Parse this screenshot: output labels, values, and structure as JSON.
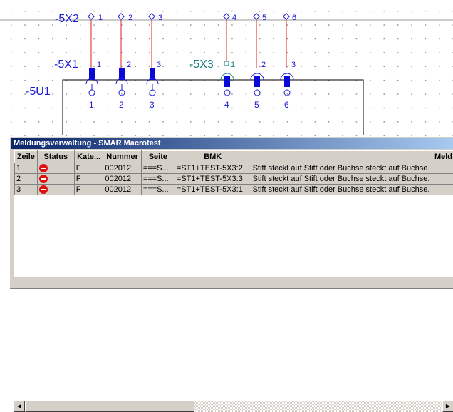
{
  "schematic": {
    "device_label": "-5U1",
    "strip_top": {
      "label": "-5X2",
      "pins_left": [
        "1",
        "2",
        "3"
      ],
      "pins_right": [
        "4",
        "5",
        "6"
      ]
    },
    "strip_mid_left": {
      "label": "-5X1",
      "pins": [
        "1",
        "2",
        "3"
      ]
    },
    "strip_mid_right": {
      "label": "-5X3",
      "pins": [
        "1",
        "2",
        "3"
      ]
    },
    "bottom_numbers": [
      "1",
      "2",
      "3",
      "4",
      "5",
      "6"
    ],
    "colors": {
      "label_blue": "#1a1ad6",
      "label_teal": "#1a8080",
      "wire_red": "#e02020",
      "block_blue": "#0a0ad8"
    }
  },
  "dialog": {
    "title": "Meldungsverwaltung - SMAR Macrotest",
    "columns": [
      "Zeile",
      "Status",
      "Kate...",
      "Nummer",
      "Seite",
      "BMK",
      "Meld"
    ],
    "rows": [
      {
        "zeile": "1",
        "status": "error-icon",
        "kategorie": "F",
        "nummer": "002012",
        "seite": "===S...",
        "bmk": "=ST1+TEST-5X3:2",
        "meldung": "Stift steckt auf Stift oder Buchse steckt auf Buchse."
      },
      {
        "zeile": "2",
        "status": "error-icon",
        "kategorie": "F",
        "nummer": "002012",
        "seite": "===S...",
        "bmk": "=ST1+TEST-5X3:3",
        "meldung": "Stift steckt auf Stift oder Buchse steckt auf Buchse."
      },
      {
        "zeile": "3",
        "status": "error-icon",
        "kategorie": "F",
        "nummer": "002012",
        "seite": "===S...",
        "bmk": "=ST1+TEST-5X3:1",
        "meldung": "Stift steckt auf Stift oder Buchse steckt auf Buchse."
      }
    ]
  }
}
